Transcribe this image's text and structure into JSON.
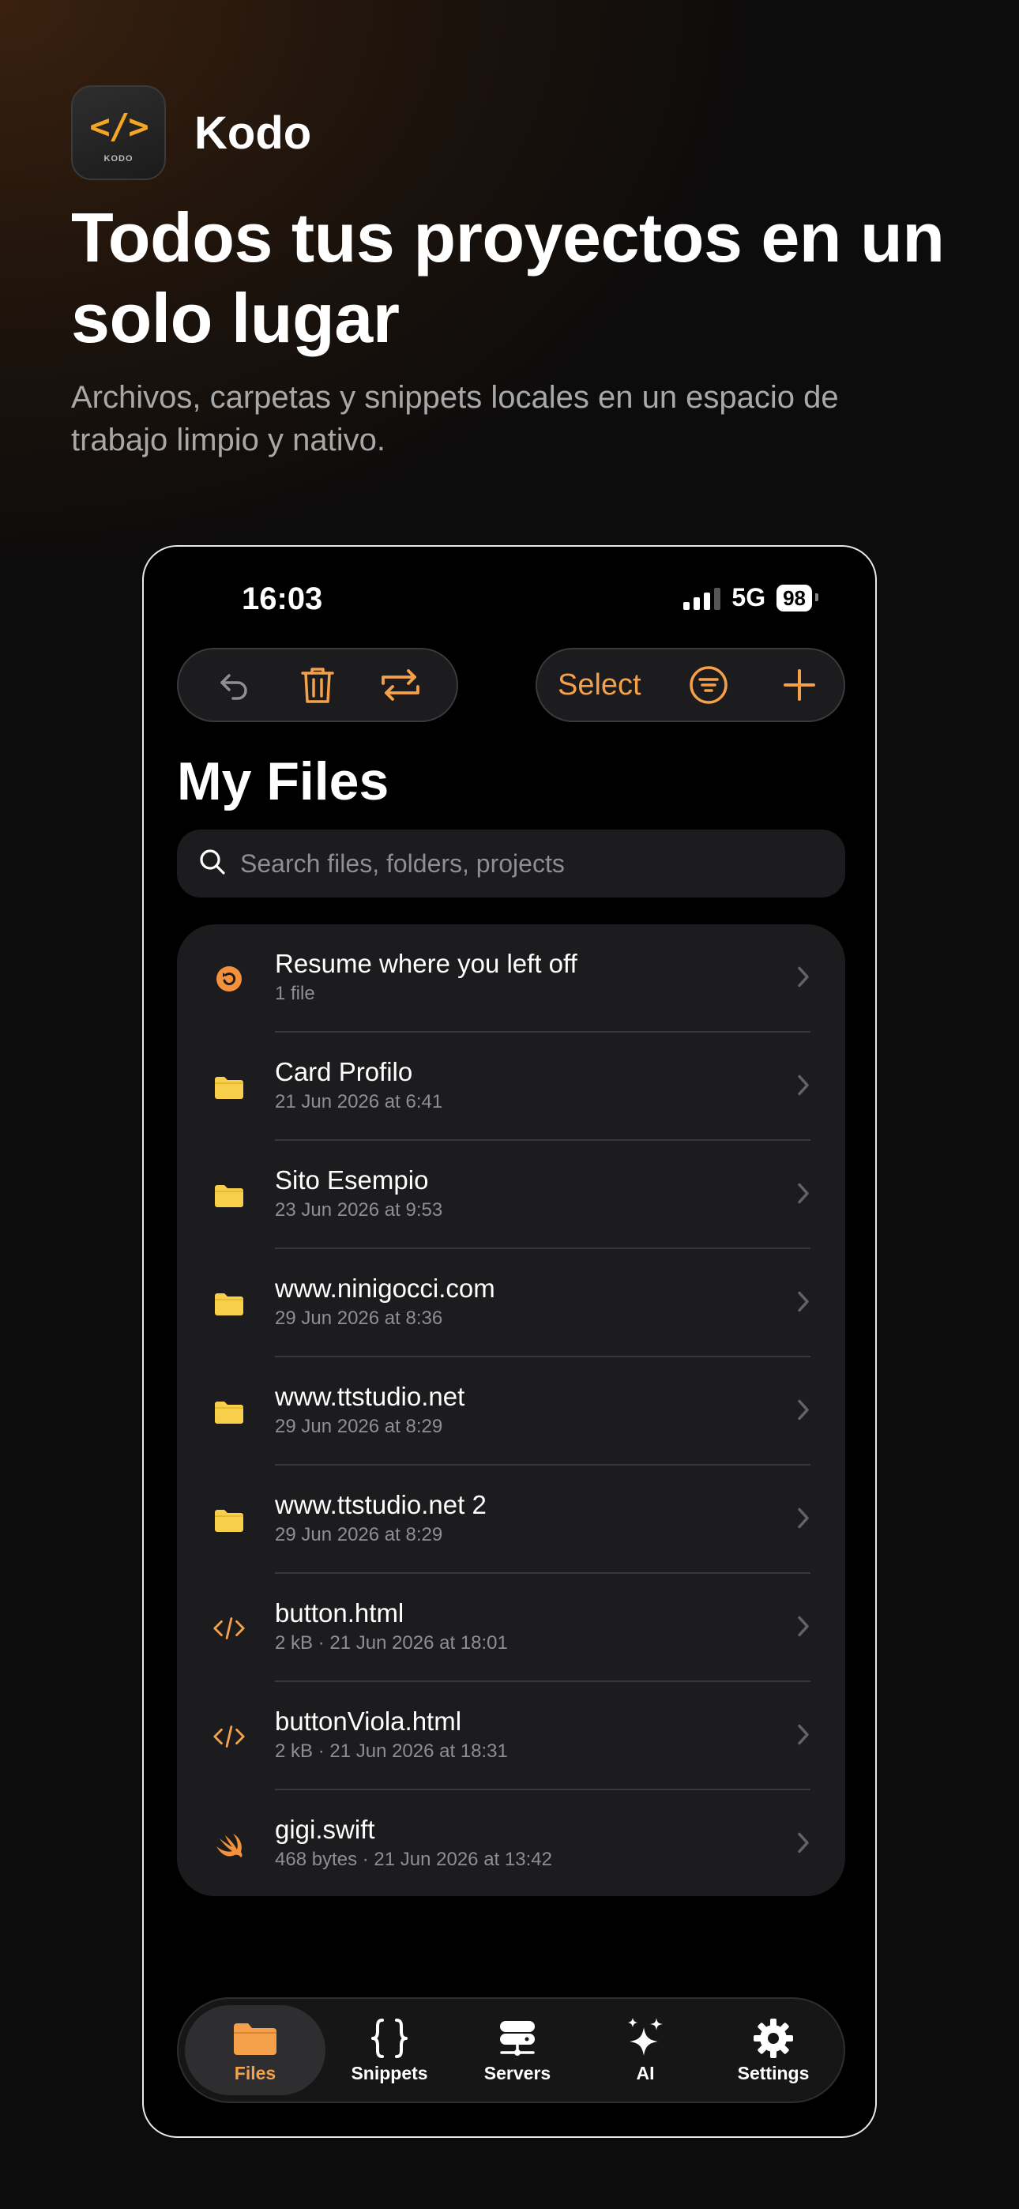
{
  "hero": {
    "app_name": "Kodo",
    "icon_code": "</>",
    "icon_caption": "KODO",
    "headline": "Todos tus proyectos en un solo lugar",
    "subline": "Archivos, carpetas y snippets locales en un espacio de trabajo limpio y nativo."
  },
  "status": {
    "time": "16:03",
    "network": "5G",
    "battery": "98"
  },
  "toolbar": {
    "select_label": "Select"
  },
  "page": {
    "title": "My Files"
  },
  "search": {
    "placeholder": "Search files, folders, projects"
  },
  "items": [
    {
      "name": "Resume where you left off",
      "meta": "1 file",
      "icon": "resume-icon"
    },
    {
      "name": "Card Profilo",
      "meta": "21 Jun 2026 at 6:41",
      "icon": "folder-icon"
    },
    {
      "name": "Sito Esempio",
      "meta": "23 Jun 2026 at 9:53",
      "icon": "folder-icon"
    },
    {
      "name": "www.ninigocci.com",
      "meta": "29 Jun 2026 at 8:36",
      "icon": "folder-icon"
    },
    {
      "name": "www.ttstudio.net",
      "meta": "29 Jun 2026 at 8:29",
      "icon": "folder-icon"
    },
    {
      "name": "www.ttstudio.net 2",
      "meta": "29 Jun 2026 at 8:29",
      "icon": "folder-icon"
    },
    {
      "name": "button.html",
      "meta": "2 kB · 21 Jun 2026 at 18:01",
      "icon": "html-code-icon"
    },
    {
      "name": "buttonViola.html",
      "meta": "2 kB · 21 Jun 2026 at 18:31",
      "icon": "html-code-icon"
    },
    {
      "name": "gigi.swift",
      "meta": "468 bytes · 21 Jun 2026 at 13:42",
      "icon": "swift-icon"
    }
  ],
  "tabs": [
    {
      "label": "Files",
      "icon": "folder-icon",
      "active": true
    },
    {
      "label": "Snippets",
      "icon": "braces-icon"
    },
    {
      "label": "Servers",
      "icon": "server-icon"
    },
    {
      "label": "AI",
      "icon": "sparkles-icon"
    },
    {
      "label": "Settings",
      "icon": "gear-icon"
    }
  ],
  "colors": {
    "accent": "#f5a04a",
    "folder": "#f7cf4a",
    "background": "#000000",
    "card": "#1c1c1e"
  }
}
